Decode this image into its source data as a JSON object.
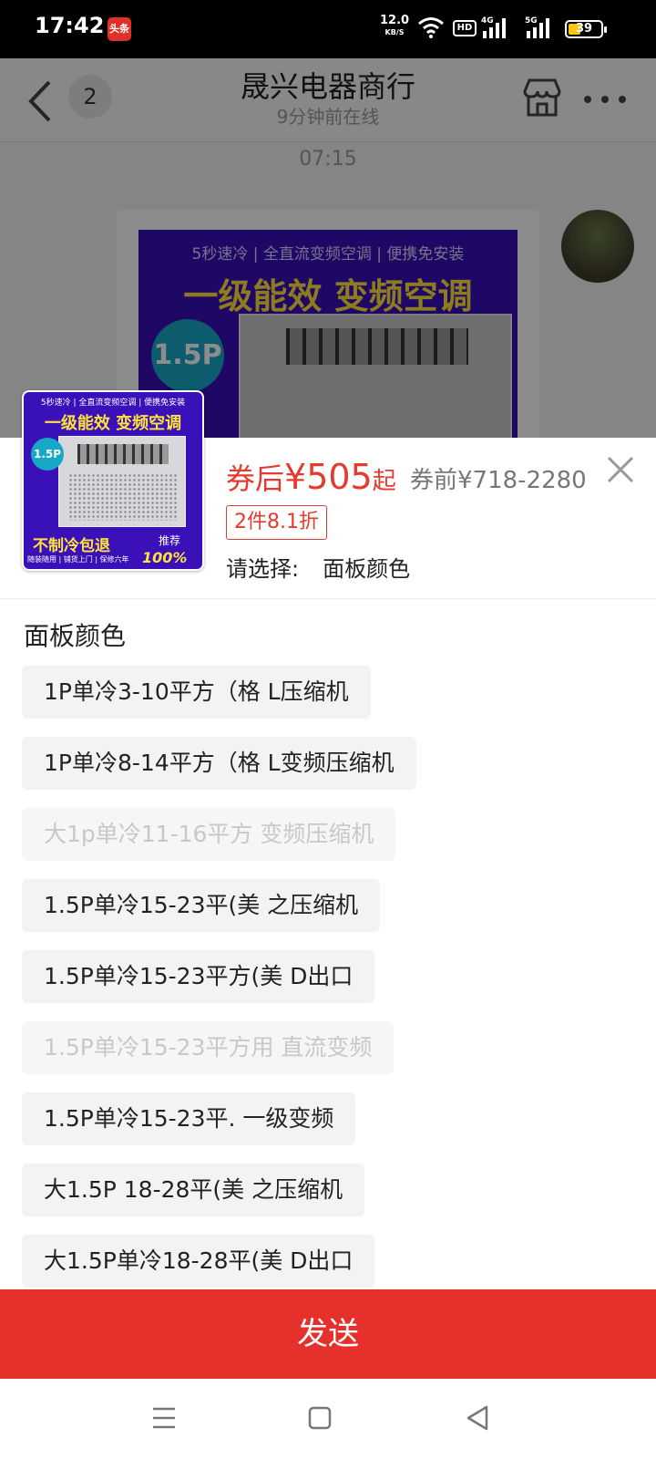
{
  "status_bar": {
    "time": "17:42",
    "app_badge": "头条",
    "net_speed": "12.0",
    "net_unit": "KB/S",
    "hd_label": "HD",
    "sig1_label": "4G",
    "sig2_label": "5G",
    "battery": "39",
    "battery_color": "#f5c518"
  },
  "chat": {
    "unread_count": "2",
    "shop_name": "晟兴电器商行",
    "online_status": "9分钟前在线",
    "message_time": "07:15",
    "banner_tagline": "5秒速冷 | 全直流变频空调 | 便携免安装",
    "banner_headline": "一级能效 变频空调",
    "banner_badge": "1.5P"
  },
  "product": {
    "thumb_tagline": "5秒速冷 | 全直流变频空调 | 便携免安装",
    "thumb_headline": "一级能效 变频空调",
    "thumb_badge": "1.5P",
    "thumb_promo": "不制冷包退",
    "thumb_recommend": "推荐",
    "thumb_percent": "100%",
    "thumb_bottom": "随装随用 | 铺货上门 | 保修六年",
    "price_prefix": "券后",
    "price_value": "¥505",
    "price_suffix": "起",
    "price_before": "券前¥718-2280",
    "discount_tag": "2件8.1折",
    "select_label": "请选择:",
    "select_value": "面板颜色"
  },
  "options": {
    "group_title": "面板颜色",
    "items": [
      {
        "label": "1P单冷3-10平方（格 L压缩机",
        "enabled": true
      },
      {
        "label": "1P单冷8-14平方（格 L变频压缩机",
        "enabled": true
      },
      {
        "label": "大1p单冷11-16平方 变频压缩机",
        "enabled": false
      },
      {
        "label": "1.5P单冷15-23平(美 之压缩机",
        "enabled": true
      },
      {
        "label": "1.5P单冷15-23平方(美 D出口",
        "enabled": true
      },
      {
        "label": "1.5P单冷15-23平方用 直流变频",
        "enabled": false
      },
      {
        "label": "1.5P单冷15-23平. 一级变频",
        "enabled": true
      },
      {
        "label": "大1.5P 18-28平(美 之压缩机",
        "enabled": true
      },
      {
        "label": "大1.5P单冷18-28平(美 D出口",
        "enabled": true
      }
    ]
  },
  "send_button": "发送",
  "accent_color": "#e5302b"
}
